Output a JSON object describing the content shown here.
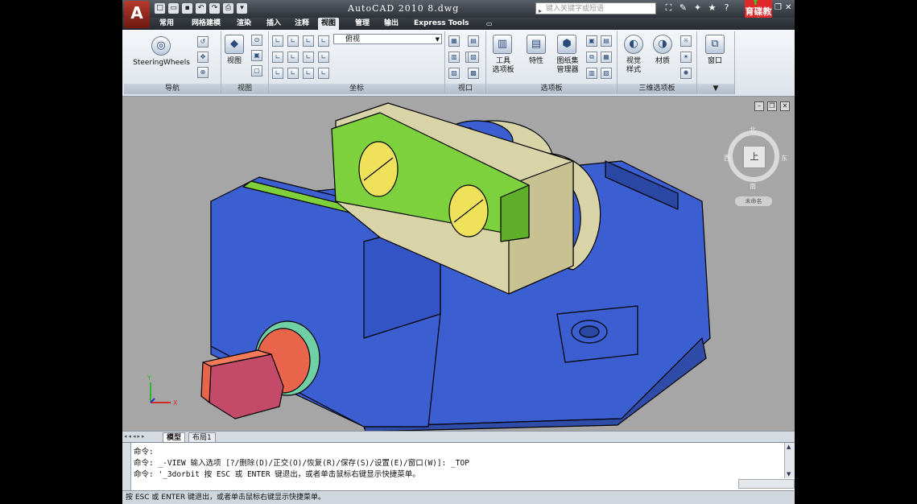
{
  "window": {
    "title": "AutoCAD 2010   8.dwg",
    "app_button": "A",
    "search_placeholder": "键入关键字或短语",
    "logo_text": "育碟教育"
  },
  "tabs": [
    {
      "label": "常用"
    },
    {
      "label": "网格建模"
    },
    {
      "label": "渲染"
    },
    {
      "label": "插入"
    },
    {
      "label": "注释"
    },
    {
      "label": "视图",
      "active": true
    },
    {
      "label": "管理"
    },
    {
      "label": "输出"
    },
    {
      "label": "Express Tools"
    }
  ],
  "ribbon": {
    "nav": {
      "title": "导航",
      "steering": "SteeringWheels"
    },
    "view": {
      "title": "视图",
      "button": "视图"
    },
    "ucs": {
      "title": "坐标",
      "dropdown": "俯视"
    },
    "viewports": {
      "title": "视口"
    },
    "palettes": {
      "title": "选项板",
      "tool_palettes": "工具\n选项板",
      "properties": "特性",
      "sheet_set": "图纸集\n管理器"
    },
    "palettes3d": {
      "title": "三维选项板",
      "visual_styles": "视觉\n样式",
      "materials": "材质"
    },
    "window": {
      "title": "",
      "button": "窗口"
    }
  },
  "viewcube": {
    "face": "上",
    "north": "北",
    "south": "南",
    "west": "西",
    "east": "东",
    "wcs": "未命名"
  },
  "layout_tabs": [
    {
      "label": "模型",
      "active": true
    },
    {
      "label": "布局1"
    }
  ],
  "command": {
    "lines": [
      "命令:",
      "命令: _-VIEW 输入选项 [?/删除(D)/正交(O)/恢复(R)/保存(S)/设置(E)/窗口(W)]: _TOP",
      "命令: '_3dorbit 按 ESC 或 ENTER 键退出，或者单击鼠标右键显示快捷菜单。"
    ]
  },
  "status_bar": "按 ESC 或 ENTER 键退出，或者单击鼠标右键显示快捷菜单。",
  "colors": {
    "vise_body": "#3d63d6",
    "jaw_green": "#7cd13c",
    "beige": "#d8d3a6",
    "screw_yellow": "#efe25a",
    "handle": "#e8644a",
    "viewport_bg": "#a6a6a6"
  }
}
